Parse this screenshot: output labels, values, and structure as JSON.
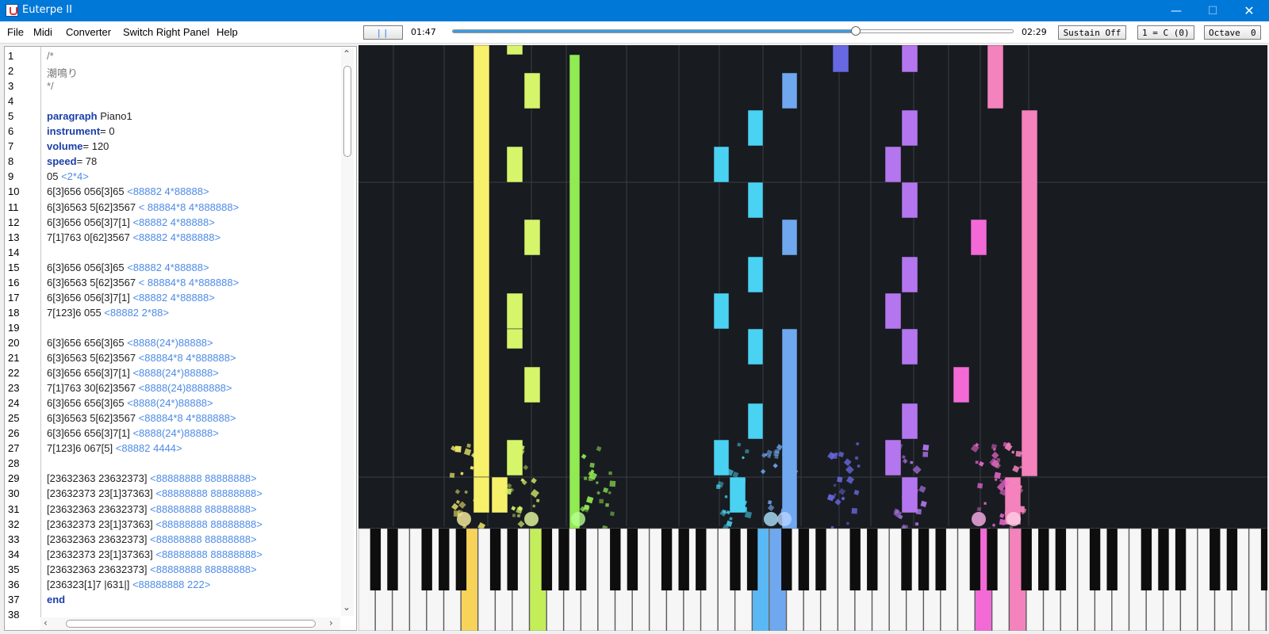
{
  "window": {
    "title": "Euterpe II",
    "minimize_icon": "minimize-icon",
    "maximize_icon": "maximize-icon",
    "close_icon": "close-icon"
  },
  "menu": {
    "file": "File",
    "midi": "Midi",
    "converter": "Converter",
    "switch_panel": "Switch Right Panel",
    "help": "Help"
  },
  "toolbar": {
    "play_pause_icon": "pause-icon",
    "current_time": "01:47",
    "total_time": "02:29",
    "progress": 0.718,
    "sustain": "Sustain Off",
    "key": "1 = C (0)",
    "octave": "Octave  0"
  },
  "editor": {
    "lines": [
      [
        [
          "c",
          "/*"
        ]
      ],
      [
        [
          "c",
          "潮鳴り"
        ]
      ],
      [
        [
          "c",
          "*/"
        ]
      ],
      [],
      [
        [
          "k",
          "paragraph"
        ],
        [
          "t",
          " Piano1"
        ]
      ],
      [
        [
          "k",
          "instrument"
        ],
        [
          "t",
          "= 0"
        ]
      ],
      [
        [
          "k",
          "volume"
        ],
        [
          "t",
          "= 120"
        ]
      ],
      [
        [
          "k",
          "speed"
        ],
        [
          "t",
          "= 78"
        ]
      ],
      [
        [
          "t",
          "05 "
        ],
        [
          "a",
          "<2*4>"
        ]
      ],
      [
        [
          "t",
          "6[3]656 056[3]65 "
        ],
        [
          "a",
          "<88882 4*88888>"
        ]
      ],
      [
        [
          "t",
          "6[3]6563 5[62]3567 "
        ],
        [
          "a",
          "< 88884*8 4*888888>"
        ]
      ],
      [
        [
          "t",
          "6[3]656 056[3]7[1] "
        ],
        [
          "a",
          "<88882 4*88888>"
        ]
      ],
      [
        [
          "t",
          "7[1]763 0[62]3567 "
        ],
        [
          "a",
          "<88882 4*888888>"
        ]
      ],
      [],
      [
        [
          "t",
          "6[3]656 056[3]65 "
        ],
        [
          "a",
          "<88882 4*88888>"
        ]
      ],
      [
        [
          "t",
          "6[3]6563 5[62]3567 "
        ],
        [
          "a",
          "< 88884*8 4*888888>"
        ]
      ],
      [
        [
          "t",
          "6[3]656 056[3]7[1] "
        ],
        [
          "a",
          "<88882 4*88888>"
        ]
      ],
      [
        [
          "t",
          "7[123]6 055 "
        ],
        [
          "a",
          "<88882 2*88>"
        ]
      ],
      [],
      [
        [
          "t",
          "6[3]656 656[3]65 "
        ],
        [
          "a",
          "<8888(24*)88888>"
        ]
      ],
      [
        [
          "t",
          "6[3]6563 5[62]3567 "
        ],
        [
          "a",
          "<88884*8 4*888888>"
        ]
      ],
      [
        [
          "t",
          "6[3]656 656[3]7[1] "
        ],
        [
          "a",
          "<8888(24*)88888>"
        ]
      ],
      [
        [
          "t",
          "7[1]763 30[62]3567 "
        ],
        [
          "a",
          "<8888(24)8888888>"
        ]
      ],
      [
        [
          "t",
          "6[3]656 656[3]65 "
        ],
        [
          "a",
          "<8888(24*)88888>"
        ]
      ],
      [
        [
          "t",
          "6[3]6563 5[62]3567 "
        ],
        [
          "a",
          "<88884*8 4*888888>"
        ]
      ],
      [
        [
          "t",
          "6[3]656 656[3]7[1] "
        ],
        [
          "a",
          "<8888(24*)88888>"
        ]
      ],
      [
        [
          "t",
          "7[123]6 067[5] "
        ],
        [
          "a",
          "<88882 4444>"
        ]
      ],
      [],
      [
        [
          "t",
          "[23632363 23632373] "
        ],
        [
          "a",
          "<88888888 88888888>"
        ]
      ],
      [
        [
          "t",
          "[23632373 23[1]37363] "
        ],
        [
          "a",
          "<88888888 88888888>"
        ]
      ],
      [
        [
          "t",
          "[23632363 23632373] "
        ],
        [
          "a",
          "<88888888 88888888>"
        ]
      ],
      [
        [
          "t",
          "[23632373 23[1]37363] "
        ],
        [
          "a",
          "<88888888 88888888>"
        ]
      ],
      [
        [
          "t",
          "[23632363 23632373] "
        ],
        [
          "a",
          "<88888888 88888888>"
        ]
      ],
      [
        [
          "t",
          "[23632373 23[1]37363] "
        ],
        [
          "a",
          "<88888888 88888888>"
        ]
      ],
      [
        [
          "t",
          "[23632363 23632373] "
        ],
        [
          "a",
          "<88888888 88888888>"
        ]
      ],
      [
        [
          "t",
          "[236323[1]7 |631|] "
        ],
        [
          "a",
          "<88888888 222>"
        ]
      ],
      [
        [
          "k",
          "end"
        ]
      ],
      []
    ],
    "line_numbers": [
      "1",
      "2",
      "3",
      "4",
      "5",
      "6",
      "7",
      "8",
      "9",
      "10",
      "11",
      "12",
      "13",
      "14",
      "15",
      "16",
      "17",
      "18",
      "19",
      "20",
      "21",
      "22",
      "23",
      "24",
      "25",
      "26",
      "27",
      "28",
      "29",
      "30",
      "31",
      "32",
      "33",
      "34",
      "35",
      "36",
      "37",
      "38"
    ]
  },
  "piano_roll": {
    "colors": [
      "#f7f06a",
      "#d6f56a",
      "#92ea52",
      "#4ad2f2",
      "#6fa8ee",
      "#6868e2",
      "#b476ee",
      "#f36ad6",
      "#f482bc"
    ],
    "active_keys": [
      {
        "white_index": 6,
        "color": "#f7d35a"
      },
      {
        "white_index": 10,
        "color": "#c4ed5a"
      },
      {
        "white_index": 23,
        "color": "#5ab8f4"
      },
      {
        "white_index": 24,
        "color": "#6fa8ee"
      },
      {
        "white_index": 36,
        "color": "#f36ad6"
      },
      {
        "white_index": 38,
        "color": "#f482bc"
      }
    ]
  }
}
